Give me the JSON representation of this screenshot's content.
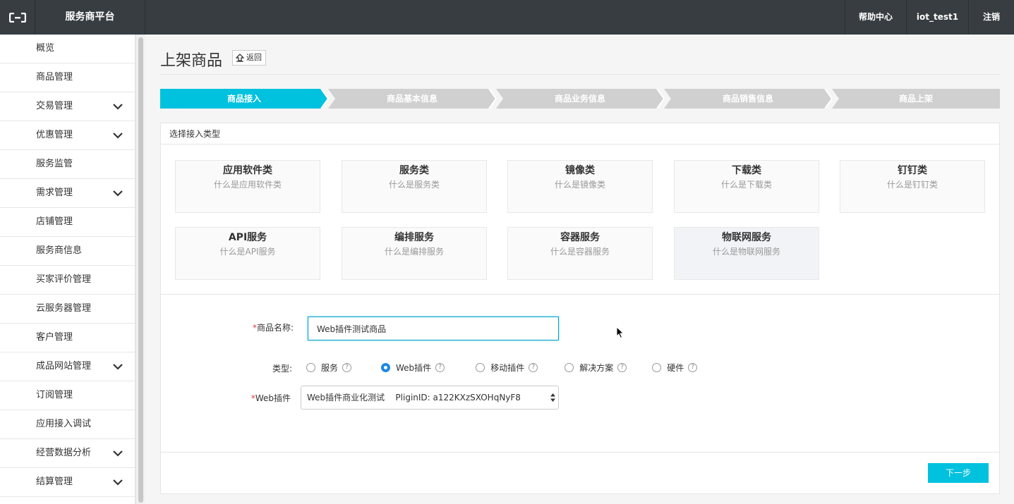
{
  "topbar": {
    "title": "服务商平台",
    "help": "帮助中心",
    "user": "iot_test1",
    "logout": "注销"
  },
  "sidebar": {
    "items": [
      {
        "label": "概览",
        "expandable": false
      },
      {
        "label": "商品管理",
        "expandable": false
      },
      {
        "label": "交易管理",
        "expandable": true
      },
      {
        "label": "优惠管理",
        "expandable": true
      },
      {
        "label": "服务监管",
        "expandable": false
      },
      {
        "label": "需求管理",
        "expandable": true
      },
      {
        "label": "店铺管理",
        "expandable": false
      },
      {
        "label": "服务商信息",
        "expandable": false
      },
      {
        "label": "买家评价管理",
        "expandable": false
      },
      {
        "label": "云服务器管理",
        "expandable": false
      },
      {
        "label": "客户管理",
        "expandable": false
      },
      {
        "label": "成品网站管理",
        "expandable": true
      },
      {
        "label": "订阅管理",
        "expandable": false
      },
      {
        "label": "应用接入调试",
        "expandable": false
      },
      {
        "label": "经营数据分析",
        "expandable": true
      },
      {
        "label": "结算管理",
        "expandable": true
      }
    ]
  },
  "page": {
    "title": "上架商品",
    "back": "返回"
  },
  "steps": [
    {
      "label": "商品接入",
      "active": true
    },
    {
      "label": "商品基本信息",
      "active": false
    },
    {
      "label": "商品业务信息",
      "active": false
    },
    {
      "label": "商品销售信息",
      "active": false
    },
    {
      "label": "商品上架",
      "active": false
    }
  ],
  "card": {
    "header": "选择接入类型",
    "types": [
      {
        "name": "应用软件类",
        "desc": "什么是应用软件类"
      },
      {
        "name": "服务类",
        "desc": "什么是服务类"
      },
      {
        "name": "镜像类",
        "desc": "什么是镜像类"
      },
      {
        "name": "下载类",
        "desc": "什么是下载类"
      },
      {
        "name": "钉钉类",
        "desc": "什么是钉钉类"
      },
      {
        "name": "API服务",
        "desc": "什么是API服务"
      },
      {
        "name": "编排服务",
        "desc": "什么是编排服务"
      },
      {
        "name": "容器服务",
        "desc": "什么是容器服务"
      },
      {
        "name": "物联网服务",
        "desc": "什么是物联网服务"
      }
    ]
  },
  "form": {
    "required_mark": "*",
    "name_label": "商品名称:",
    "name_value": "Web插件测试商品",
    "type_label": "类型:",
    "type_options": [
      {
        "label": "服务",
        "checked": false
      },
      {
        "label": "Web插件",
        "checked": true
      },
      {
        "label": "移动插件",
        "checked": false
      },
      {
        "label": "解决方案",
        "checked": false
      },
      {
        "label": "硬件",
        "checked": false
      }
    ],
    "help_glyph": "?",
    "plugin_label": "Web插件",
    "plugin_value": "Web插件商业化测试    PliginID: a122KXzSXOHqNyF8",
    "next": "下一步"
  },
  "colors": {
    "topbar": "#373d41",
    "accent": "#00c1de",
    "step_inactive": "#d0d0d0",
    "radio_checked": "#1e88e5",
    "required": "#e4393c"
  }
}
